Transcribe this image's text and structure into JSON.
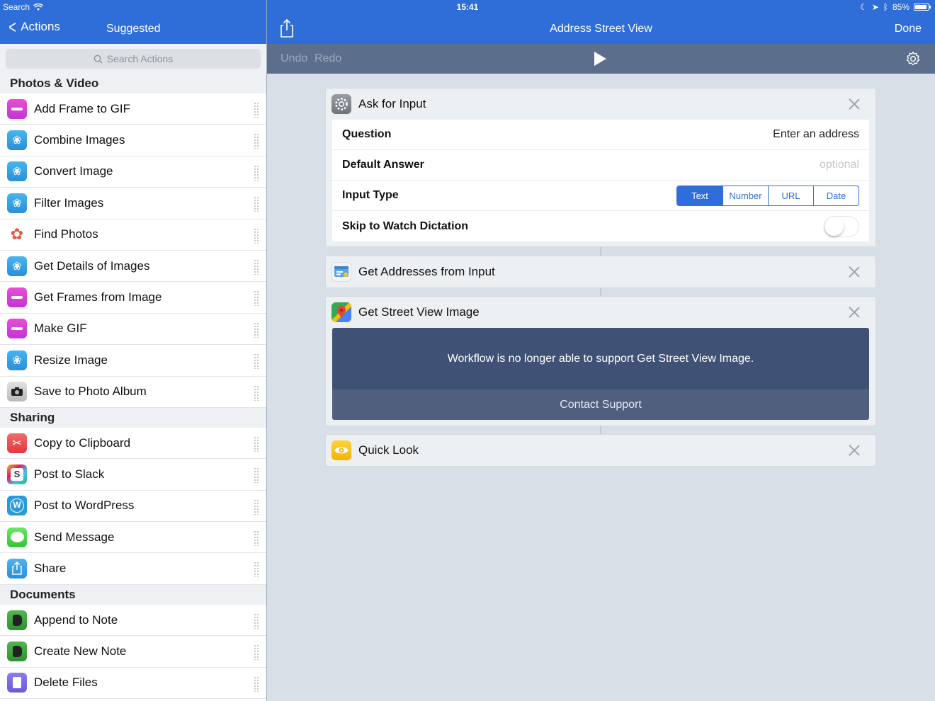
{
  "status": {
    "carrier": "Search",
    "time": "15:41",
    "battery": "85%"
  },
  "nav": {
    "back_label": "Actions",
    "suggested_label": "Suggested",
    "title": "Address Street View",
    "done_label": "Done"
  },
  "toolbar": {
    "undo_label": "Undo",
    "redo_label": "Redo"
  },
  "sidebar": {
    "search_placeholder": "Search Actions",
    "sections": [
      {
        "title": "Photos & Video",
        "items": [
          {
            "label": "Add Frame to GIF",
            "icon": "gif-icon"
          },
          {
            "label": "Combine Images",
            "icon": "image-icon"
          },
          {
            "label": "Convert Image",
            "icon": "image-icon"
          },
          {
            "label": "Filter Images",
            "icon": "image-icon"
          },
          {
            "label": "Find Photos",
            "icon": "photos-icon"
          },
          {
            "label": "Get Details of Images",
            "icon": "image-icon"
          },
          {
            "label": "Get Frames from Image",
            "icon": "gif-icon"
          },
          {
            "label": "Make GIF",
            "icon": "gif-icon"
          },
          {
            "label": "Resize Image",
            "icon": "image-icon"
          },
          {
            "label": "Save to Photo Album",
            "icon": "camera-icon"
          }
        ]
      },
      {
        "title": "Sharing",
        "items": [
          {
            "label": "Copy to Clipboard",
            "icon": "scissors-icon"
          },
          {
            "label": "Post to Slack",
            "icon": "slack-icon"
          },
          {
            "label": "Post to WordPress",
            "icon": "wordpress-icon"
          },
          {
            "label": "Send Message",
            "icon": "message-icon"
          },
          {
            "label": "Share",
            "icon": "share-icon"
          }
        ]
      },
      {
        "title": "Documents",
        "items": [
          {
            "label": "Append to Note",
            "icon": "evernote-icon"
          },
          {
            "label": "Create New Note",
            "icon": "evernote-icon"
          },
          {
            "label": "Delete Files",
            "icon": "files-icon"
          }
        ]
      }
    ]
  },
  "workflow": {
    "ask": {
      "title": "Ask for Input",
      "question_label": "Question",
      "question_value": "Enter an address",
      "default_label": "Default Answer",
      "default_placeholder": "optional",
      "input_type_label": "Input Type",
      "input_types": [
        "Text",
        "Number",
        "URL",
        "Date"
      ],
      "selected_type": "Text",
      "skip_label": "Skip to Watch Dictation",
      "skip_on": false
    },
    "addresses": {
      "title": "Get Addresses from Input"
    },
    "streetview": {
      "title": "Get Street View Image",
      "message": "Workflow is no longer able to support Get Street View Image.",
      "contact_label": "Contact Support"
    },
    "quicklook": {
      "title": "Quick Look"
    }
  },
  "colors": {
    "accent": "#2f6ed8",
    "toolbar": "#5b6f8c",
    "warning_bg": "#3f5174"
  }
}
